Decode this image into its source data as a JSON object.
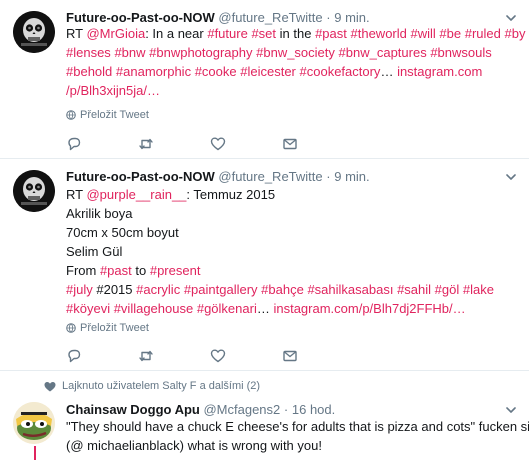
{
  "tweets": [
    {
      "name": "Future-oo-Past-oo-NOW",
      "handle": "@future_ReTwitte",
      "time": "9 min.",
      "lines": [
        [
          {
            "t": "RT "
          },
          {
            "t": "@MrGioia",
            "l": 1
          },
          {
            "t": ": In a near "
          },
          {
            "t": "#future",
            "l": 1
          },
          {
            "t": " "
          },
          {
            "t": "#set",
            "l": 1
          },
          {
            "t": " in the "
          },
          {
            "t": "#past",
            "l": 1
          },
          {
            "t": " "
          },
          {
            "t": "#theworld",
            "l": 1
          },
          {
            "t": " "
          },
          {
            "t": "#will",
            "l": 1
          },
          {
            "t": " "
          },
          {
            "t": "#be",
            "l": 1
          },
          {
            "t": " "
          },
          {
            "t": "#ruled",
            "l": 1
          },
          {
            "t": " "
          },
          {
            "t": "#by",
            "l": 1
          }
        ],
        [
          {
            "t": "#lenses",
            "l": 1
          },
          {
            "t": " "
          },
          {
            "t": "#bnw",
            "l": 1
          },
          {
            "t": " "
          },
          {
            "t": "#bnwphotography",
            "l": 1
          },
          {
            "t": " "
          },
          {
            "t": "#bnw_society",
            "l": 1
          },
          {
            "t": " "
          },
          {
            "t": "#bnw_captures",
            "l": 1
          },
          {
            "t": " "
          },
          {
            "t": "#bnwsouls",
            "l": 1
          }
        ],
        [
          {
            "t": "#behold",
            "l": 1
          },
          {
            "t": " "
          },
          {
            "t": "#anamorphic",
            "l": 1
          },
          {
            "t": " "
          },
          {
            "t": "#cooke",
            "l": 1
          },
          {
            "t": " "
          },
          {
            "t": "#leicester",
            "l": 1
          },
          {
            "t": " "
          },
          {
            "t": "#cookefactory",
            "l": 1
          },
          {
            "t": "… "
          },
          {
            "t": "instagram.com",
            "l": 1
          }
        ],
        [
          {
            "t": "/p/Blh3xijn5ja/…",
            "l": 1
          }
        ]
      ],
      "translate_label": "Přeložit Tweet"
    },
    {
      "name": "Future-oo-Past-oo-NOW",
      "handle": "@future_ReTwitte",
      "time": "9 min.",
      "lines": [
        [
          {
            "t": "RT "
          },
          {
            "t": "@purple__rain__",
            "l": 1
          },
          {
            "t": ": Temmuz 2015"
          }
        ],
        [
          {
            "t": "Akrilik boya"
          }
        ],
        [
          {
            "t": "70cm x 50cm boyut"
          }
        ],
        [
          {
            "t": "Selim Gül"
          }
        ],
        [
          {
            "t": "From "
          },
          {
            "t": "#past",
            "l": 1
          },
          {
            "t": " to "
          },
          {
            "t": "#present",
            "l": 1
          }
        ],
        [
          {
            "t": "#july",
            "l": 1
          },
          {
            "t": " #2015 "
          },
          {
            "t": "#acrylic",
            "l": 1
          },
          {
            "t": " "
          },
          {
            "t": "#paintgallery",
            "l": 1
          },
          {
            "t": " "
          },
          {
            "t": "#bahçe",
            "l": 1
          },
          {
            "t": " "
          },
          {
            "t": "#sahilkasabası",
            "l": 1
          },
          {
            "t": " "
          },
          {
            "t": "#sahil",
            "l": 1
          },
          {
            "t": " "
          },
          {
            "t": "#göl",
            "l": 1
          },
          {
            "t": " "
          },
          {
            "t": "#lake",
            "l": 1
          }
        ],
        [
          {
            "t": "#köyevi",
            "l": 1
          },
          {
            "t": " "
          },
          {
            "t": "#villagehouse",
            "l": 1
          },
          {
            "t": " "
          },
          {
            "t": "#gölkenari",
            "l": 1
          },
          {
            "t": "… "
          },
          {
            "t": "instagram.com/p/Blh7dj2FFHb/…",
            "l": 1
          }
        ]
      ],
      "translate_label": "Přeložit Tweet"
    },
    {
      "social_context": "Lajknuto uživatelem Salty F a dalšími (2)",
      "name": "Chainsaw Doggo Apu",
      "handle": "@Mcfagens2",
      "time": "16 hod.",
      "lines": [
        [
          {
            "t": "\"They should have a chuck E cheese's for adults that is pizza and cots\"  fucken sick!"
          }
        ],
        [
          {
            "t": "(@ michaelianblack) what is wrong with you!"
          }
        ]
      ]
    }
  ],
  "separator": "·",
  "colors": {
    "link": "#e0245e",
    "muted": "#657786",
    "text": "#14171a",
    "border": "#e6ecf0"
  },
  "icons": [
    "chevron-down-icon",
    "globe-icon",
    "reply-icon",
    "retweet-icon",
    "like-icon",
    "message-icon",
    "heart-icon"
  ]
}
